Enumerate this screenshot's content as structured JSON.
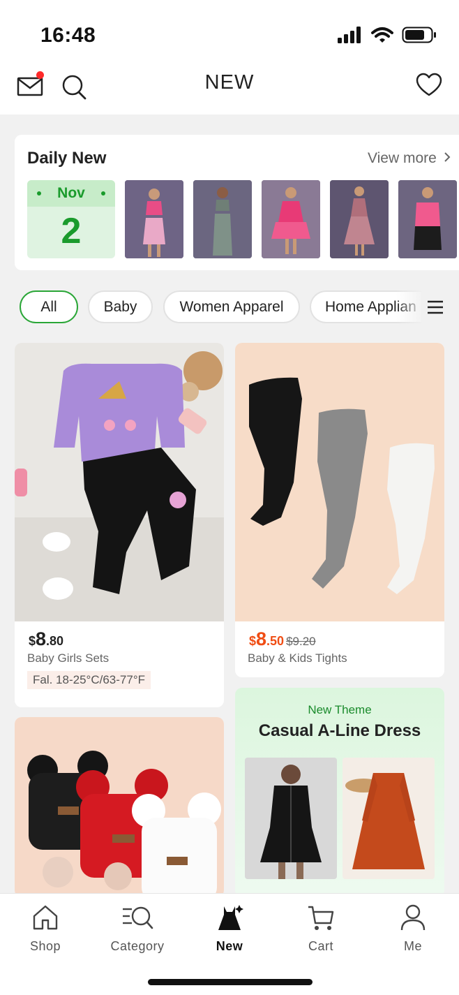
{
  "status_bar": {
    "time": "16:48"
  },
  "header": {
    "title": "NEW"
  },
  "daily_new": {
    "title": "Daily New",
    "view_more": "View more",
    "month": "Nov",
    "day": "2"
  },
  "chips": [
    "All",
    "Baby",
    "Women Apparel",
    "Home Applian"
  ],
  "products": [
    {
      "currency": "$",
      "price_int": "8",
      "price_dec": ".80",
      "old_price": "",
      "name": "Baby Girls Sets",
      "tag": "Fal. 18-25°C/63-77°F"
    },
    {
      "currency": "$",
      "price_int": "8",
      "price_dec": ".50",
      "old_price": "$9.20",
      "name": "Baby & Kids Tights",
      "tag": ""
    }
  ],
  "theme": {
    "label": "New Theme",
    "title": "Casual A-Line Dress"
  },
  "tabs": [
    {
      "label": "Shop",
      "icon": "home-icon"
    },
    {
      "label": "Category",
      "icon": "category-search-icon"
    },
    {
      "label": "New",
      "icon": "dress-sparkle-icon"
    },
    {
      "label": "Cart",
      "icon": "cart-icon"
    },
    {
      "label": "Me",
      "icon": "person-icon"
    }
  ],
  "colors": {
    "accent_green": "#1a9b2c",
    "sale_orange": "#f04d14",
    "notification_red": "#ff2a2a"
  }
}
